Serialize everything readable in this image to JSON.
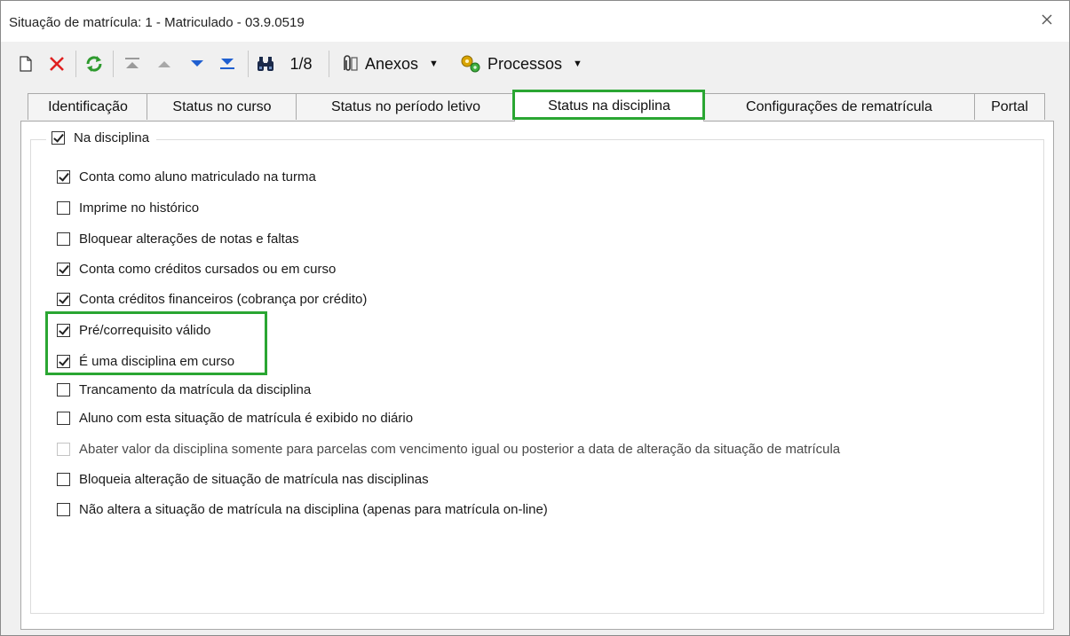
{
  "window": {
    "title": "Situação de matrícula: 1 - Matriculado - 03.9.0519",
    "close_icon": "close-icon"
  },
  "toolbar": {
    "record_position": "1/8",
    "attachments_label": "Anexos",
    "processes_label": "Processos"
  },
  "tabs": [
    {
      "label": "Identificação"
    },
    {
      "label": "Status no curso"
    },
    {
      "label": "Status no período letivo"
    },
    {
      "label": "Status na disciplina",
      "active": true
    },
    {
      "label": "Configurações de rematrícula"
    },
    {
      "label": "Portal"
    }
  ],
  "group": {
    "label": "Na disciplina",
    "checked": true
  },
  "options": [
    {
      "label": "Conta como aluno matriculado na turma",
      "checked": true
    },
    {
      "label": "Imprime no histórico",
      "checked": false
    },
    {
      "label": "Bloquear alterações de notas e faltas",
      "checked": false
    },
    {
      "label": "Conta como créditos cursados ou em curso",
      "checked": true
    },
    {
      "label": "Conta créditos financeiros (cobrança por crédito)",
      "checked": true
    },
    {
      "label": "Pré/correquisito válido",
      "checked": true
    },
    {
      "label": "É uma disciplina em curso",
      "checked": true
    },
    {
      "label": "Trancamento da matrícula da disciplina",
      "checked": false
    },
    {
      "label": "Aluno com esta situação de matrícula é exibido no diário",
      "checked": false
    },
    {
      "label": "Abater valor da disciplina somente para parcelas com vencimento igual ou posterior a data de alteração da situação de matrícula",
      "checked": false,
      "disabled": true
    },
    {
      "label": "Bloqueia alteração de situação de matrícula nas disciplinas",
      "checked": false
    },
    {
      "label": "Não altera a situação de matrícula na disciplina (apenas para matrícula on-line)",
      "checked": false
    }
  ],
  "colors": {
    "highlight": "#2aa632",
    "delete_red": "#e02020",
    "refresh_green": "#2e9a2e",
    "nav_blue": "#1f5fd0"
  }
}
